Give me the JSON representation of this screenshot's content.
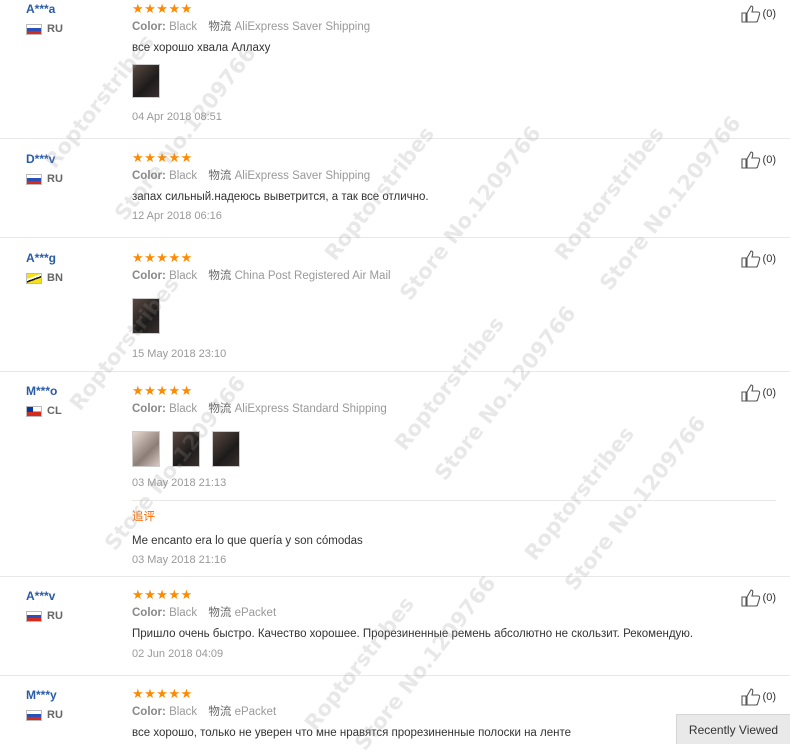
{
  "reviews": [
    {
      "user": "A***a",
      "country": "RU",
      "flag": "ru",
      "stars": "★★★★★",
      "color_label": "Color:",
      "color": "Black",
      "ship_icon": "物流",
      "shipping": "AliExpress Saver Shipping",
      "text": "все хорошо хвала Аллаху",
      "photos": [
        "dark"
      ],
      "date": "04 Apr 2018 08:51",
      "likes": "(0)"
    },
    {
      "user": "D***v",
      "country": "RU",
      "flag": "ru",
      "stars": "★★★★★",
      "color_label": "Color:",
      "color": "Black",
      "ship_icon": "物流",
      "shipping": "AliExpress Saver Shipping",
      "text": "запах сильный.надеюсь выветрится, а так все отлично.",
      "photos": [],
      "date": "12 Apr 2018 06:16",
      "likes": "(0)"
    },
    {
      "user": "A***g",
      "country": "BN",
      "flag": "bn",
      "stars": "★★★★★",
      "color_label": "Color:",
      "color": "Black",
      "ship_icon": "物流",
      "shipping": "China Post Registered Air Mail",
      "text": "",
      "photos": [
        "dark"
      ],
      "date": "15 May 2018 23:10",
      "likes": "(0)"
    },
    {
      "user": "M***o",
      "country": "CL",
      "flag": "cl",
      "stars": "★★★★★",
      "color_label": "Color:",
      "color": "Black",
      "ship_icon": "物流",
      "shipping": "AliExpress Standard Shipping",
      "text": "",
      "photos": [
        "light",
        "dark",
        "dark"
      ],
      "date": "03 May 2018 21:13",
      "likes": "(0)",
      "followup": {
        "label": "追评",
        "text": "Me encanto era lo que quería y son cómodas",
        "date": "03 May 2018 21:16"
      }
    },
    {
      "user": "A***v",
      "country": "RU",
      "flag": "ru",
      "stars": "★★★★★",
      "color_label": "Color:",
      "color": "Black",
      "ship_icon": "物流",
      "shipping": "ePacket",
      "text": "Пришло очень быстро. Качество хорошее. Прорезиненные ремень абсолютно не скользит. Рекомендую.",
      "photos": [],
      "date": "02 Jun 2018 04:09",
      "likes": "(0)"
    },
    {
      "user": "M***y",
      "country": "RU",
      "flag": "ru",
      "stars": "★★★★★",
      "color_label": "Color:",
      "color": "Black",
      "ship_icon": "物流",
      "shipping": "ePacket",
      "text": "все хорошо, только не уверен что мне нравятся прорезиненные полоски на ленте",
      "photos": [],
      "date": "",
      "likes": "(0)"
    }
  ],
  "watermarks": [
    "Roptorstribes",
    "Store No.1209766"
  ],
  "recently_viewed": "Recently Viewed",
  "colors": {
    "user_link": "#2a5ba8",
    "stars": "#ff8a00",
    "followup": "#ff6a00"
  }
}
